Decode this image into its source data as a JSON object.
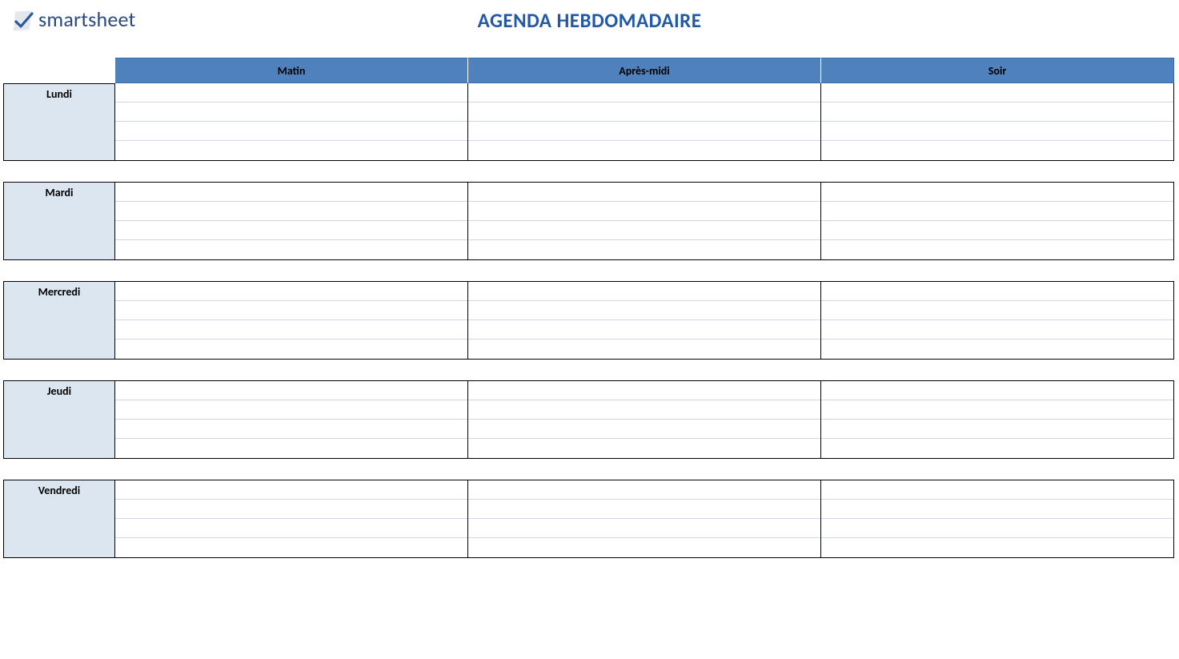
{
  "app": {
    "logo_text": "smartsheet",
    "title": "AGENDA HEBDOMADAIRE"
  },
  "columns": [
    "Matin",
    "Après-midi",
    "Soir"
  ],
  "days": [
    {
      "label": "Lundi",
      "rows": [
        [
          "",
          "",
          ""
        ],
        [
          "",
          "",
          ""
        ],
        [
          "",
          "",
          ""
        ],
        [
          "",
          "",
          ""
        ]
      ]
    },
    {
      "label": "Mardi",
      "rows": [
        [
          "",
          "",
          ""
        ],
        [
          "",
          "",
          ""
        ],
        [
          "",
          "",
          ""
        ],
        [
          "",
          "",
          ""
        ]
      ]
    },
    {
      "label": "Mercredi",
      "rows": [
        [
          "",
          "",
          ""
        ],
        [
          "",
          "",
          ""
        ],
        [
          "",
          "",
          ""
        ],
        [
          "",
          "",
          ""
        ]
      ]
    },
    {
      "label": "Jeudi",
      "rows": [
        [
          "",
          "",
          ""
        ],
        [
          "",
          "",
          ""
        ],
        [
          "",
          "",
          ""
        ],
        [
          "",
          "",
          ""
        ]
      ]
    },
    {
      "label": "Vendredi",
      "rows": [
        [
          "",
          "",
          ""
        ],
        [
          "",
          "",
          ""
        ],
        [
          "",
          "",
          ""
        ],
        [
          "",
          "",
          ""
        ]
      ]
    }
  ]
}
